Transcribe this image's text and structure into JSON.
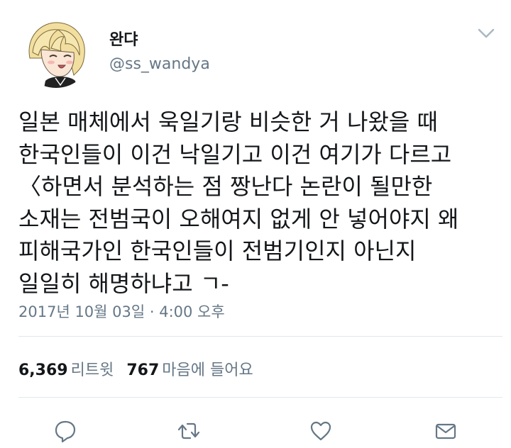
{
  "tweet": {
    "display_name": "완댜",
    "handle": "@ss_wandya",
    "text_lines": [
      "일본 매체에서 욱일기랑 비슷한 거 나왔을 때",
      "한국인들이 이건 낙일기고 이건 여기가 다르고",
      "〈하면서 분석하는 점 짱난다 논란이 될만한",
      "소재는 전범국이 오해여지 없게 안 넣어야지 왜",
      "피해국가인 한국인들이 전범기인지 아닌지",
      "일일히 해명하냐고 ㄱ-"
    ],
    "timestamp": "2017년 10월 03일 · 4:00 오후",
    "retweet_count": "6,369",
    "retweet_label": "리트윗",
    "like_count": "767",
    "like_label": "마음에 들어요"
  },
  "icons": {
    "more": "chevron-down-icon",
    "reply": "reply-icon",
    "retweet": "retweet-icon",
    "like": "heart-icon",
    "dm": "mail-icon"
  },
  "colors": {
    "text": "#14171a",
    "secondary": "#657786",
    "divider": "#e1e8ed",
    "icon": "#657786"
  }
}
